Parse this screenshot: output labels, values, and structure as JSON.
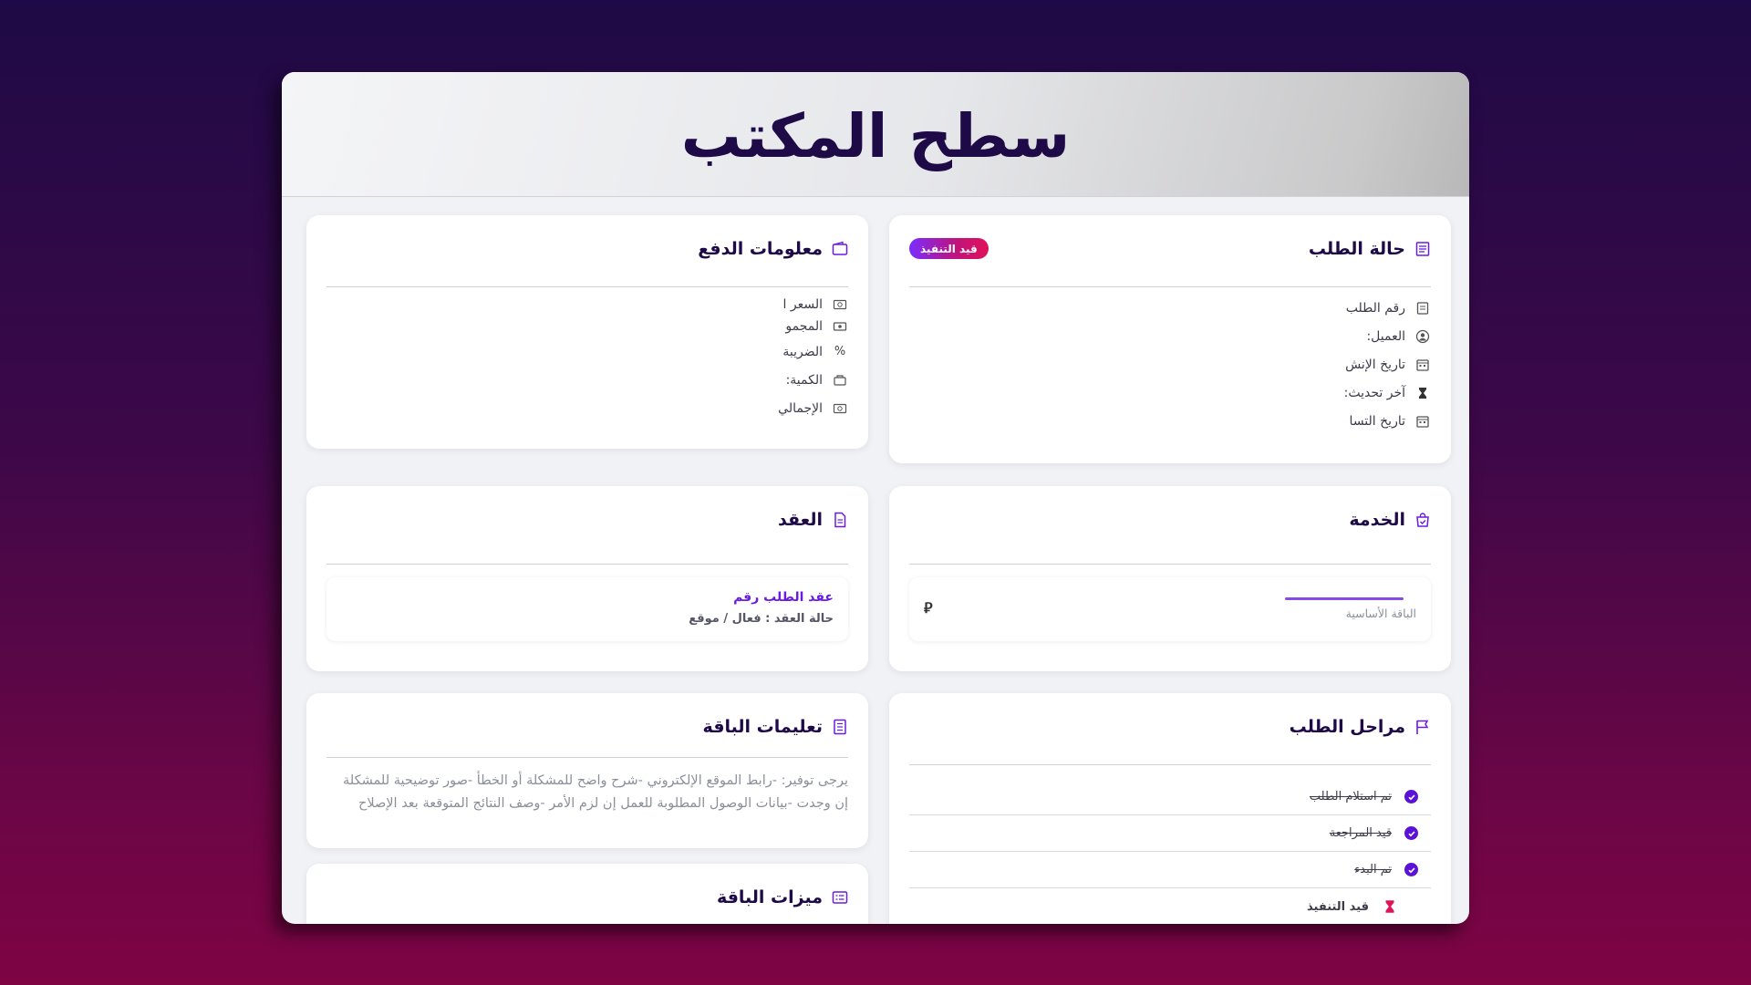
{
  "page": {
    "title": "سطح المكتب"
  },
  "order_status": {
    "title": "حالة الطلب",
    "badge": "قيد التنفيذ",
    "rows": [
      {
        "label": "رقم الطلب",
        "icon": "receipt-icon"
      },
      {
        "label": "العميل:",
        "icon": "user-circle-icon"
      },
      {
        "label": "تاريخ الإنش",
        "icon": "calendar-icon"
      },
      {
        "label": "آخر تحديث:",
        "icon": "hourglass-icon"
      },
      {
        "label": "تاريخ التسا",
        "icon": "calendar-icon"
      }
    ]
  },
  "payment": {
    "title": "معلومات الدفع",
    "rows": [
      {
        "label": "السعر ا",
        "icon": "money-icon"
      },
      {
        "label": "المجمو",
        "icon": "cash-icon"
      },
      {
        "label": "الضريبة",
        "icon": "percent-icon"
      },
      {
        "label": "الكمية:",
        "icon": "box-icon"
      },
      {
        "label": "الإجمالي",
        "icon": "money-icon"
      }
    ]
  },
  "service": {
    "title": "الخدمة",
    "package": "الباقة الأساسية",
    "currency_symbol": "⃁"
  },
  "contract": {
    "title": "العقد",
    "link": "عقد الطلب رقم",
    "status": "حالة العقد : فعال / موقع"
  },
  "stages": {
    "title": "مراحل الطلب",
    "items": [
      {
        "label": "تم استلام الطلب",
        "done": true
      },
      {
        "label": "قيد المراجعة",
        "done": true
      },
      {
        "label": "تم البدء",
        "done": true
      },
      {
        "label": "قيد التنفيذ",
        "done": false
      }
    ]
  },
  "instructions": {
    "title": "تعليمات الباقة",
    "text": "يرجى توفير: -رابط الموقع الإلكتروني -شرح واضح للمشكلة أو الخطأ -صور توضيحية للمشكلة إن وجدت -بيانات الوصول المطلوبة للعمل إن لزم الأمر -وصف النتائج المتوقعة بعد الإصلاح"
  },
  "features": {
    "title": "ميزات الباقة"
  },
  "colors": {
    "accent": "#6a1be0",
    "title": "#1e0a46",
    "badge_start": "#7a2cff",
    "badge_end": "#e0125a",
    "pending": "#e0125a"
  }
}
